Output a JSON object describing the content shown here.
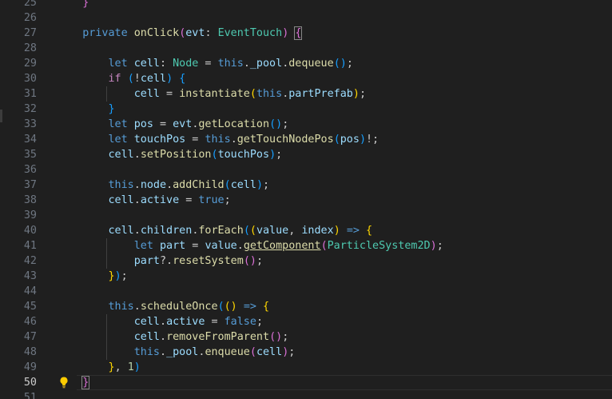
{
  "editor": {
    "current_line": 50,
    "lines": [
      {
        "n": "25",
        "t": [
          {
            "s": "    "
          },
          {
            "s": "}",
            "c": "tok-b2"
          }
        ]
      },
      {
        "n": "26",
        "t": []
      },
      {
        "n": "27",
        "t": [
          {
            "s": "    "
          },
          {
            "s": "private",
            "c": "tok-kw"
          },
          {
            "s": " "
          },
          {
            "s": "onClick",
            "c": "tok-fn"
          },
          {
            "s": "(",
            "c": "tok-b2"
          },
          {
            "s": "evt",
            "c": "tok-var"
          },
          {
            "s": ": "
          },
          {
            "s": "EventTouch",
            "c": "tok-type"
          },
          {
            "s": ")",
            "c": "tok-b2"
          },
          {
            "s": " "
          },
          {
            "s": "{",
            "c": "tok-b2 cursor-bracket"
          }
        ]
      },
      {
        "n": "28",
        "t": []
      },
      {
        "n": "29",
        "t": [
          {
            "s": "        "
          },
          {
            "s": "let",
            "c": "tok-kw"
          },
          {
            "s": " "
          },
          {
            "s": "cell",
            "c": "tok-var"
          },
          {
            "s": ": "
          },
          {
            "s": "Node",
            "c": "tok-type"
          },
          {
            "s": " = "
          },
          {
            "s": "this",
            "c": "tok-kw"
          },
          {
            "s": "."
          },
          {
            "s": "_pool",
            "c": "tok-var"
          },
          {
            "s": "."
          },
          {
            "s": "dequeue",
            "c": "tok-fn"
          },
          {
            "s": "()",
            "c": "tok-b3"
          },
          {
            "s": ";"
          }
        ]
      },
      {
        "n": "30",
        "t": [
          {
            "s": "        "
          },
          {
            "s": "if",
            "c": "tok-ctrl"
          },
          {
            "s": " "
          },
          {
            "s": "(",
            "c": "tok-b3"
          },
          {
            "s": "!"
          },
          {
            "s": "cell",
            "c": "tok-var"
          },
          {
            "s": ")",
            "c": "tok-b3"
          },
          {
            "s": " "
          },
          {
            "s": "{",
            "c": "tok-b3"
          }
        ]
      },
      {
        "n": "31",
        "t": [
          {
            "s": "            "
          },
          {
            "s": "cell",
            "c": "tok-var"
          },
          {
            "s": " = "
          },
          {
            "s": "instantiate",
            "c": "tok-fn"
          },
          {
            "s": "(",
            "c": "tok-b1"
          },
          {
            "s": "this",
            "c": "tok-kw"
          },
          {
            "s": "."
          },
          {
            "s": "partPrefab",
            "c": "tok-var"
          },
          {
            "s": ")",
            "c": "tok-b1"
          },
          {
            "s": ";"
          }
        ]
      },
      {
        "n": "32",
        "t": [
          {
            "s": "        "
          },
          {
            "s": "}",
            "c": "tok-b3"
          }
        ]
      },
      {
        "n": "33",
        "t": [
          {
            "s": "        "
          },
          {
            "s": "let",
            "c": "tok-kw"
          },
          {
            "s": " "
          },
          {
            "s": "pos",
            "c": "tok-var"
          },
          {
            "s": " = "
          },
          {
            "s": "evt",
            "c": "tok-var"
          },
          {
            "s": "."
          },
          {
            "s": "getLocation",
            "c": "tok-fn"
          },
          {
            "s": "()",
            "c": "tok-b3"
          },
          {
            "s": ";"
          }
        ]
      },
      {
        "n": "34",
        "t": [
          {
            "s": "        "
          },
          {
            "s": "let",
            "c": "tok-kw"
          },
          {
            "s": " "
          },
          {
            "s": "touchPos",
            "c": "tok-var"
          },
          {
            "s": " = "
          },
          {
            "s": "this",
            "c": "tok-kw"
          },
          {
            "s": "."
          },
          {
            "s": "getTouchNodePos",
            "c": "tok-fn"
          },
          {
            "s": "(",
            "c": "tok-b3"
          },
          {
            "s": "pos",
            "c": "tok-var"
          },
          {
            "s": ")",
            "c": "tok-b3"
          },
          {
            "s": "!;"
          }
        ]
      },
      {
        "n": "35",
        "t": [
          {
            "s": "        "
          },
          {
            "s": "cell",
            "c": "tok-var"
          },
          {
            "s": "."
          },
          {
            "s": "setPosition",
            "c": "tok-fn"
          },
          {
            "s": "(",
            "c": "tok-b3"
          },
          {
            "s": "touchPos",
            "c": "tok-var"
          },
          {
            "s": ")",
            "c": "tok-b3"
          },
          {
            "s": ";"
          }
        ]
      },
      {
        "n": "36",
        "t": []
      },
      {
        "n": "37",
        "t": [
          {
            "s": "        "
          },
          {
            "s": "this",
            "c": "tok-kw"
          },
          {
            "s": "."
          },
          {
            "s": "node",
            "c": "tok-var"
          },
          {
            "s": "."
          },
          {
            "s": "addChild",
            "c": "tok-fn"
          },
          {
            "s": "(",
            "c": "tok-b3"
          },
          {
            "s": "cell",
            "c": "tok-var"
          },
          {
            "s": ")",
            "c": "tok-b3"
          },
          {
            "s": ";"
          }
        ]
      },
      {
        "n": "38",
        "t": [
          {
            "s": "        "
          },
          {
            "s": "cell",
            "c": "tok-var"
          },
          {
            "s": "."
          },
          {
            "s": "active",
            "c": "tok-var"
          },
          {
            "s": " = "
          },
          {
            "s": "true",
            "c": "tok-kw"
          },
          {
            "s": ";"
          }
        ]
      },
      {
        "n": "39",
        "t": []
      },
      {
        "n": "40",
        "t": [
          {
            "s": "        "
          },
          {
            "s": "cell",
            "c": "tok-var"
          },
          {
            "s": "."
          },
          {
            "s": "children",
            "c": "tok-var"
          },
          {
            "s": "."
          },
          {
            "s": "forEach",
            "c": "tok-fn"
          },
          {
            "s": "(",
            "c": "tok-b3"
          },
          {
            "s": "(",
            "c": "tok-b1"
          },
          {
            "s": "value",
            "c": "tok-var"
          },
          {
            "s": ", "
          },
          {
            "s": "index",
            "c": "tok-var"
          },
          {
            "s": ")",
            "c": "tok-b1"
          },
          {
            "s": " "
          },
          {
            "s": "=>",
            "c": "tok-kw"
          },
          {
            "s": " "
          },
          {
            "s": "{",
            "c": "tok-b1"
          }
        ]
      },
      {
        "n": "41",
        "t": [
          {
            "s": "            "
          },
          {
            "s": "let",
            "c": "tok-kw"
          },
          {
            "s": " "
          },
          {
            "s": "part",
            "c": "tok-var"
          },
          {
            "s": " = "
          },
          {
            "s": "value",
            "c": "tok-var"
          },
          {
            "s": "."
          },
          {
            "s": "getComponent",
            "c": "tok-link"
          },
          {
            "s": "(",
            "c": "tok-b2"
          },
          {
            "s": "ParticleSystem2D",
            "c": "tok-type"
          },
          {
            "s": ")",
            "c": "tok-b2"
          },
          {
            "s": ";"
          }
        ]
      },
      {
        "n": "42",
        "t": [
          {
            "s": "            "
          },
          {
            "s": "part",
            "c": "tok-var"
          },
          {
            "s": "?."
          },
          {
            "s": "resetSystem",
            "c": "tok-fn"
          },
          {
            "s": "()",
            "c": "tok-b2"
          },
          {
            "s": ";"
          }
        ]
      },
      {
        "n": "43",
        "t": [
          {
            "s": "        "
          },
          {
            "s": "}",
            "c": "tok-b1"
          },
          {
            "s": ")",
            "c": "tok-b3"
          },
          {
            "s": ";"
          }
        ]
      },
      {
        "n": "44",
        "t": []
      },
      {
        "n": "45",
        "t": [
          {
            "s": "        "
          },
          {
            "s": "this",
            "c": "tok-kw"
          },
          {
            "s": "."
          },
          {
            "s": "scheduleOnce",
            "c": "tok-fn"
          },
          {
            "s": "(",
            "c": "tok-b3"
          },
          {
            "s": "()",
            "c": "tok-b1"
          },
          {
            "s": " "
          },
          {
            "s": "=>",
            "c": "tok-kw"
          },
          {
            "s": " "
          },
          {
            "s": "{",
            "c": "tok-b1"
          }
        ]
      },
      {
        "n": "46",
        "t": [
          {
            "s": "            "
          },
          {
            "s": "cell",
            "c": "tok-var"
          },
          {
            "s": "."
          },
          {
            "s": "active",
            "c": "tok-var"
          },
          {
            "s": " = "
          },
          {
            "s": "false",
            "c": "tok-kw"
          },
          {
            "s": ";"
          }
        ]
      },
      {
        "n": "47",
        "t": [
          {
            "s": "            "
          },
          {
            "s": "cell",
            "c": "tok-var"
          },
          {
            "s": "."
          },
          {
            "s": "removeFromParent",
            "c": "tok-fn"
          },
          {
            "s": "()",
            "c": "tok-b2"
          },
          {
            "s": ";"
          }
        ]
      },
      {
        "n": "48",
        "t": [
          {
            "s": "            "
          },
          {
            "s": "this",
            "c": "tok-kw"
          },
          {
            "s": "."
          },
          {
            "s": "_pool",
            "c": "tok-var"
          },
          {
            "s": "."
          },
          {
            "s": "enqueue",
            "c": "tok-fn"
          },
          {
            "s": "(",
            "c": "tok-b2"
          },
          {
            "s": "cell",
            "c": "tok-var"
          },
          {
            "s": ")",
            "c": "tok-b2"
          },
          {
            "s": ";"
          }
        ]
      },
      {
        "n": "49",
        "t": [
          {
            "s": "        "
          },
          {
            "s": "}",
            "c": "tok-b1"
          },
          {
            "s": ", "
          },
          {
            "s": "1",
            "c": "tok-num"
          },
          {
            "s": ")",
            "c": "tok-b3"
          }
        ]
      },
      {
        "n": "50",
        "t": [
          {
            "s": "    "
          },
          {
            "s": "}",
            "c": "tok-b2 cursor-bracket"
          }
        ]
      },
      {
        "n": "51",
        "t": []
      }
    ],
    "lightbulb_icon": "lightbulb-icon",
    "colors": {
      "background": "#1f1f1f",
      "line_number": "#6e7681",
      "keyword": "#569cd6",
      "function": "#dcdcaa",
      "type": "#4ec9b0",
      "variable": "#9cdcfe",
      "number": "#b5cea8",
      "bracket_gold": "#ffd700",
      "bracket_orchid": "#da70d6",
      "bracket_blue": "#179fff",
      "lightbulb": "#ffcc00"
    }
  }
}
